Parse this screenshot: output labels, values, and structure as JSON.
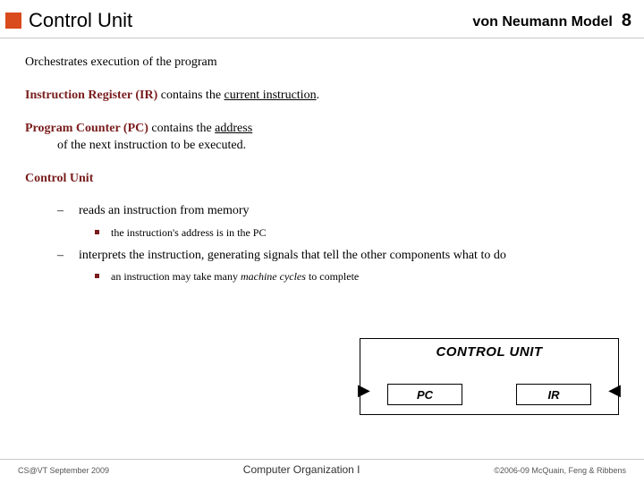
{
  "header": {
    "title": "Control Unit",
    "subject": "von Neumann Model",
    "page": "8"
  },
  "lead": "Orchestrates execution of the program",
  "ir_label": "Instruction Register (IR)",
  "ir_rest": " contains the ",
  "ir_underlined": "current instruction",
  "ir_period": ".",
  "pc_label": "Program Counter (PC)",
  "pc_rest": " contains the ",
  "pc_underlined": "address",
  "pc_tail": "of the next instruction to be executed.",
  "cu_label": "Control Unit",
  "bullets": {
    "b1": "reads an instruction from memory",
    "b1a": "the instruction's address is in the PC",
    "b2": "interprets the instruction, generating signals that tell the other components what to do",
    "b2a_pre": "an instruction may take many ",
    "b2a_it": "machine cycles",
    "b2a_post": " to complete"
  },
  "diagram": {
    "title": "CONTROL UNIT",
    "pc": "PC",
    "ir": "IR"
  },
  "footer": {
    "left": "CS@VT September 2009",
    "center": "Computer Organization I",
    "right": "©2006-09  McQuain, Feng & Ribbens"
  }
}
